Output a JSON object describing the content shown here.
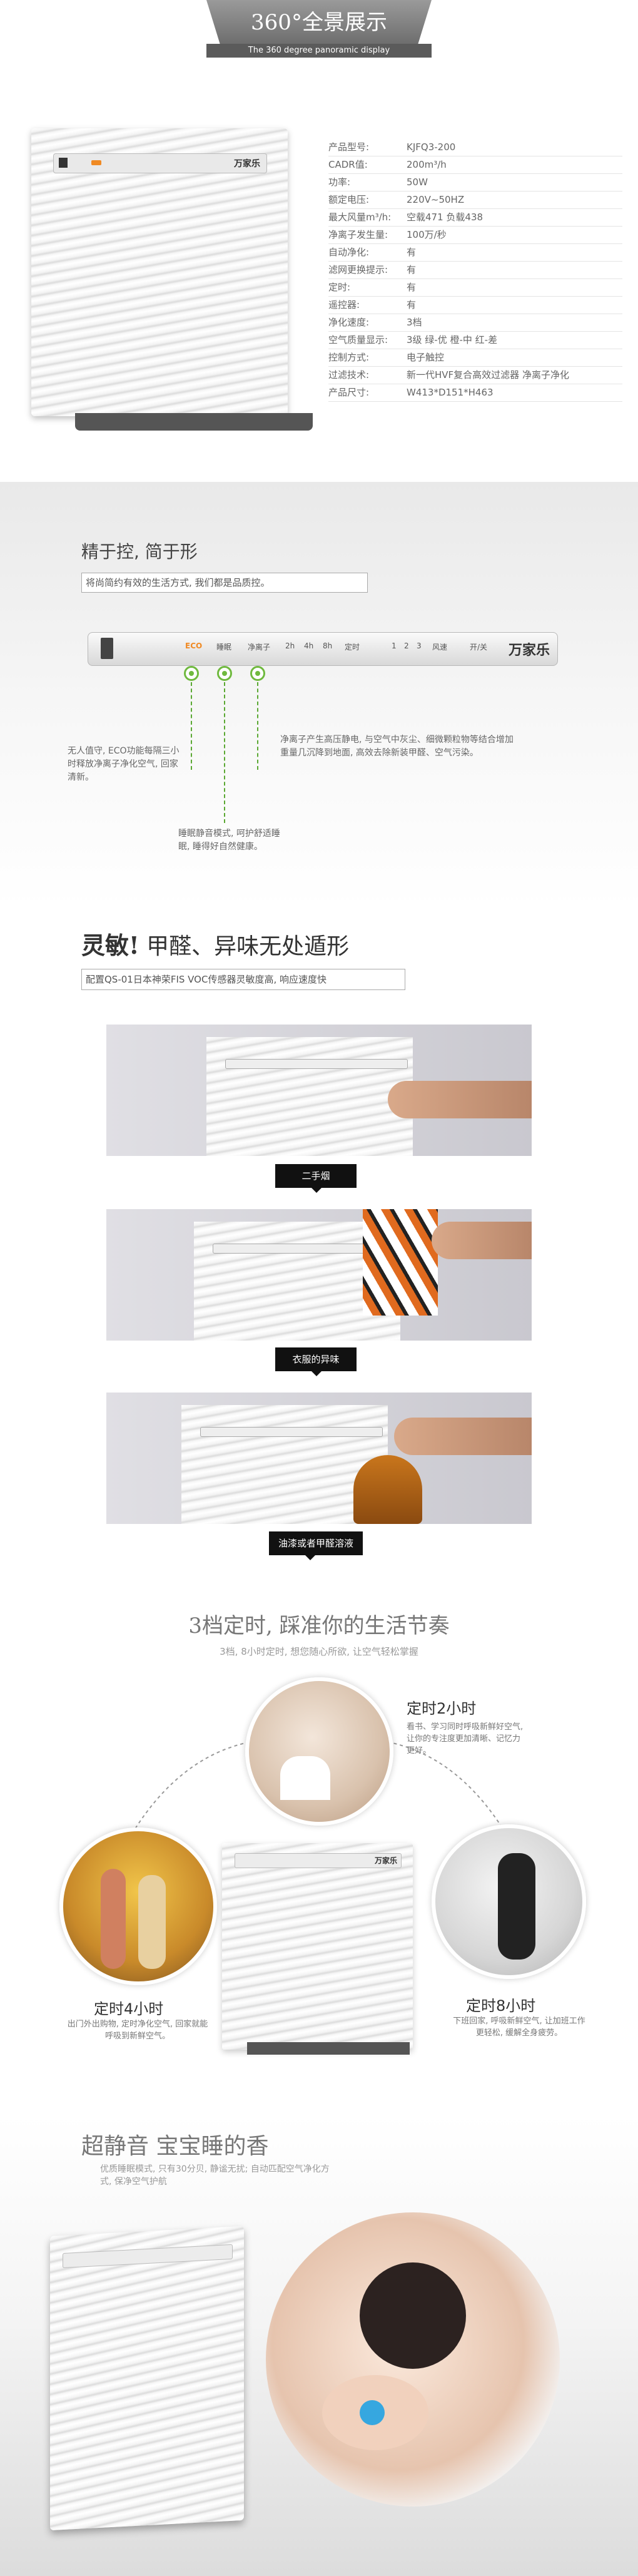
{
  "header": {
    "title": "360°全景展示",
    "subtitle": "The 360 degree panoramic display"
  },
  "product_panel": {
    "brand": "万家乐"
  },
  "specs": [
    {
      "label": "产品型号:",
      "value": "KJFQ3-200"
    },
    {
      "label": "CADR值:",
      "value": "200m³/h"
    },
    {
      "label": "功率:",
      "value": "50W"
    },
    {
      "label": "额定电压:",
      "value": "220V~50HZ"
    },
    {
      "label": "最大风量m³/h:",
      "value": "空载471  负载438"
    },
    {
      "label": " 净离子发生量:",
      "value": "100万/秒"
    },
    {
      "label": "自动净化:",
      "value": "有"
    },
    {
      "label": "滤网更换提示:",
      "value": "有"
    },
    {
      "label": "定时:",
      "value": "有"
    },
    {
      "label": "遥控器:",
      "value": "有"
    },
    {
      "label": "净化速度:",
      "value": "3档"
    },
    {
      "label": "空气质量显示:",
      "value": "3级  绿-优  橙-中  红-差"
    },
    {
      "label": "控制方式:",
      "value": "电子触控"
    },
    {
      "label": "过滤技术:",
      "value": "新一代HVF复合高效过滤器  净离子净化"
    },
    {
      "label": "产品尺寸:",
      "value": "W413*D151*H463"
    }
  ],
  "control": {
    "title": "精于控, 简于形",
    "subtitle": "将尚简约有效的生活方式, 我们都是品质控。",
    "buttons": [
      "ECO",
      "睡眠",
      "净离子",
      "2h",
      "4h",
      "8h",
      "定时",
      "1",
      "2",
      "3",
      "风速",
      "开/关"
    ],
    "brand": "万家乐",
    "note_eco": "无人值守, ECO功能每隔三小时释放净离子净化空气, 回家清新。",
    "note_sleep": "睡眠静音模式, 呵护舒适睡眠, 睡得好自然健康。",
    "note_ion": "净离子产生高压静电, 与空气中灰尘、细微颗粒物等结合增加重量几沉降到地面, 高效去除新装甲醛、空气污染。"
  },
  "sensor": {
    "title_bold": "灵敏!",
    "title_rest": " 甲醛、异味无处遁形",
    "subtitle": "配置QS-01日本神荣FIS VOC传感器灵敏度高, 响应速度快",
    "captions": [
      "二手烟",
      "衣服的异味",
      "油漆或者甲醛溶液"
    ]
  },
  "timer": {
    "title": "3档定时, 踩准你的生活节奏",
    "subtitle": "3档, 8小时定时, 想您随心所欲, 让空气轻松掌握",
    "items": [
      {
        "title": "定时2小时",
        "note": "看书、学习同时呼吸新鲜好空气, 让你的专注度更加清晰、记忆力更好。"
      },
      {
        "title": "定时4小时",
        "note": "出门外出购物, 定时净化空气, 回家就能呼吸到新鲜空气。"
      },
      {
        "title": "定时8小时",
        "note": "下班回家, 呼吸新鲜空气, 让加班工作更轻松, 缓解全身疲劳。"
      }
    ]
  },
  "silent": {
    "title": "超静音 宝宝睡的香",
    "subtitle": "优质睡眠模式, 只有30分贝, 静谧无扰; 自动匹配空气净化方式, 保净空气护航"
  },
  "colors": {
    "accent_green": "#6fb93e",
    "dark": "#111111",
    "gray_band": "#7a7a7a"
  }
}
